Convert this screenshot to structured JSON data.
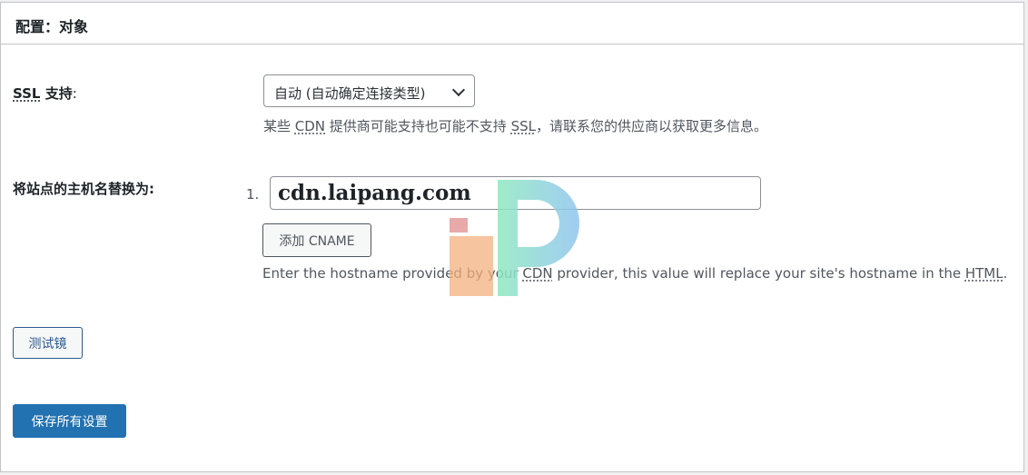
{
  "panel": {
    "title": "配置：对象"
  },
  "ssl": {
    "label_abbr": "SSL",
    "label_rest": " 支持",
    "label_colon": ":",
    "selected": "自动 (自动确定连接类型)",
    "desc_1": "某些 ",
    "desc_cdn": "CDN",
    "desc_2": " 提供商可能支持也可能不支持 ",
    "desc_ssl": "SSL",
    "desc_3": "，请联系您的供应商以获取更多信息。"
  },
  "hostname": {
    "label": "将站点的主机名替换为:",
    "list_number": "1.",
    "value": "cdn.laipang.com",
    "add_button": "添加 CNAME",
    "desc_1": "Enter the hostname provided by your ",
    "desc_cdn": "CDN",
    "desc_2": " provider, this value will replace your site's hostname in the ",
    "desc_html": "HTML",
    "desc_3": "."
  },
  "actions": {
    "test_button": "测试镜",
    "save_button": "保存所有设置"
  },
  "colors": {
    "primary": "#2271b1",
    "border": "#c3c4c7",
    "text": "#1d2327",
    "muted": "#50575e"
  }
}
